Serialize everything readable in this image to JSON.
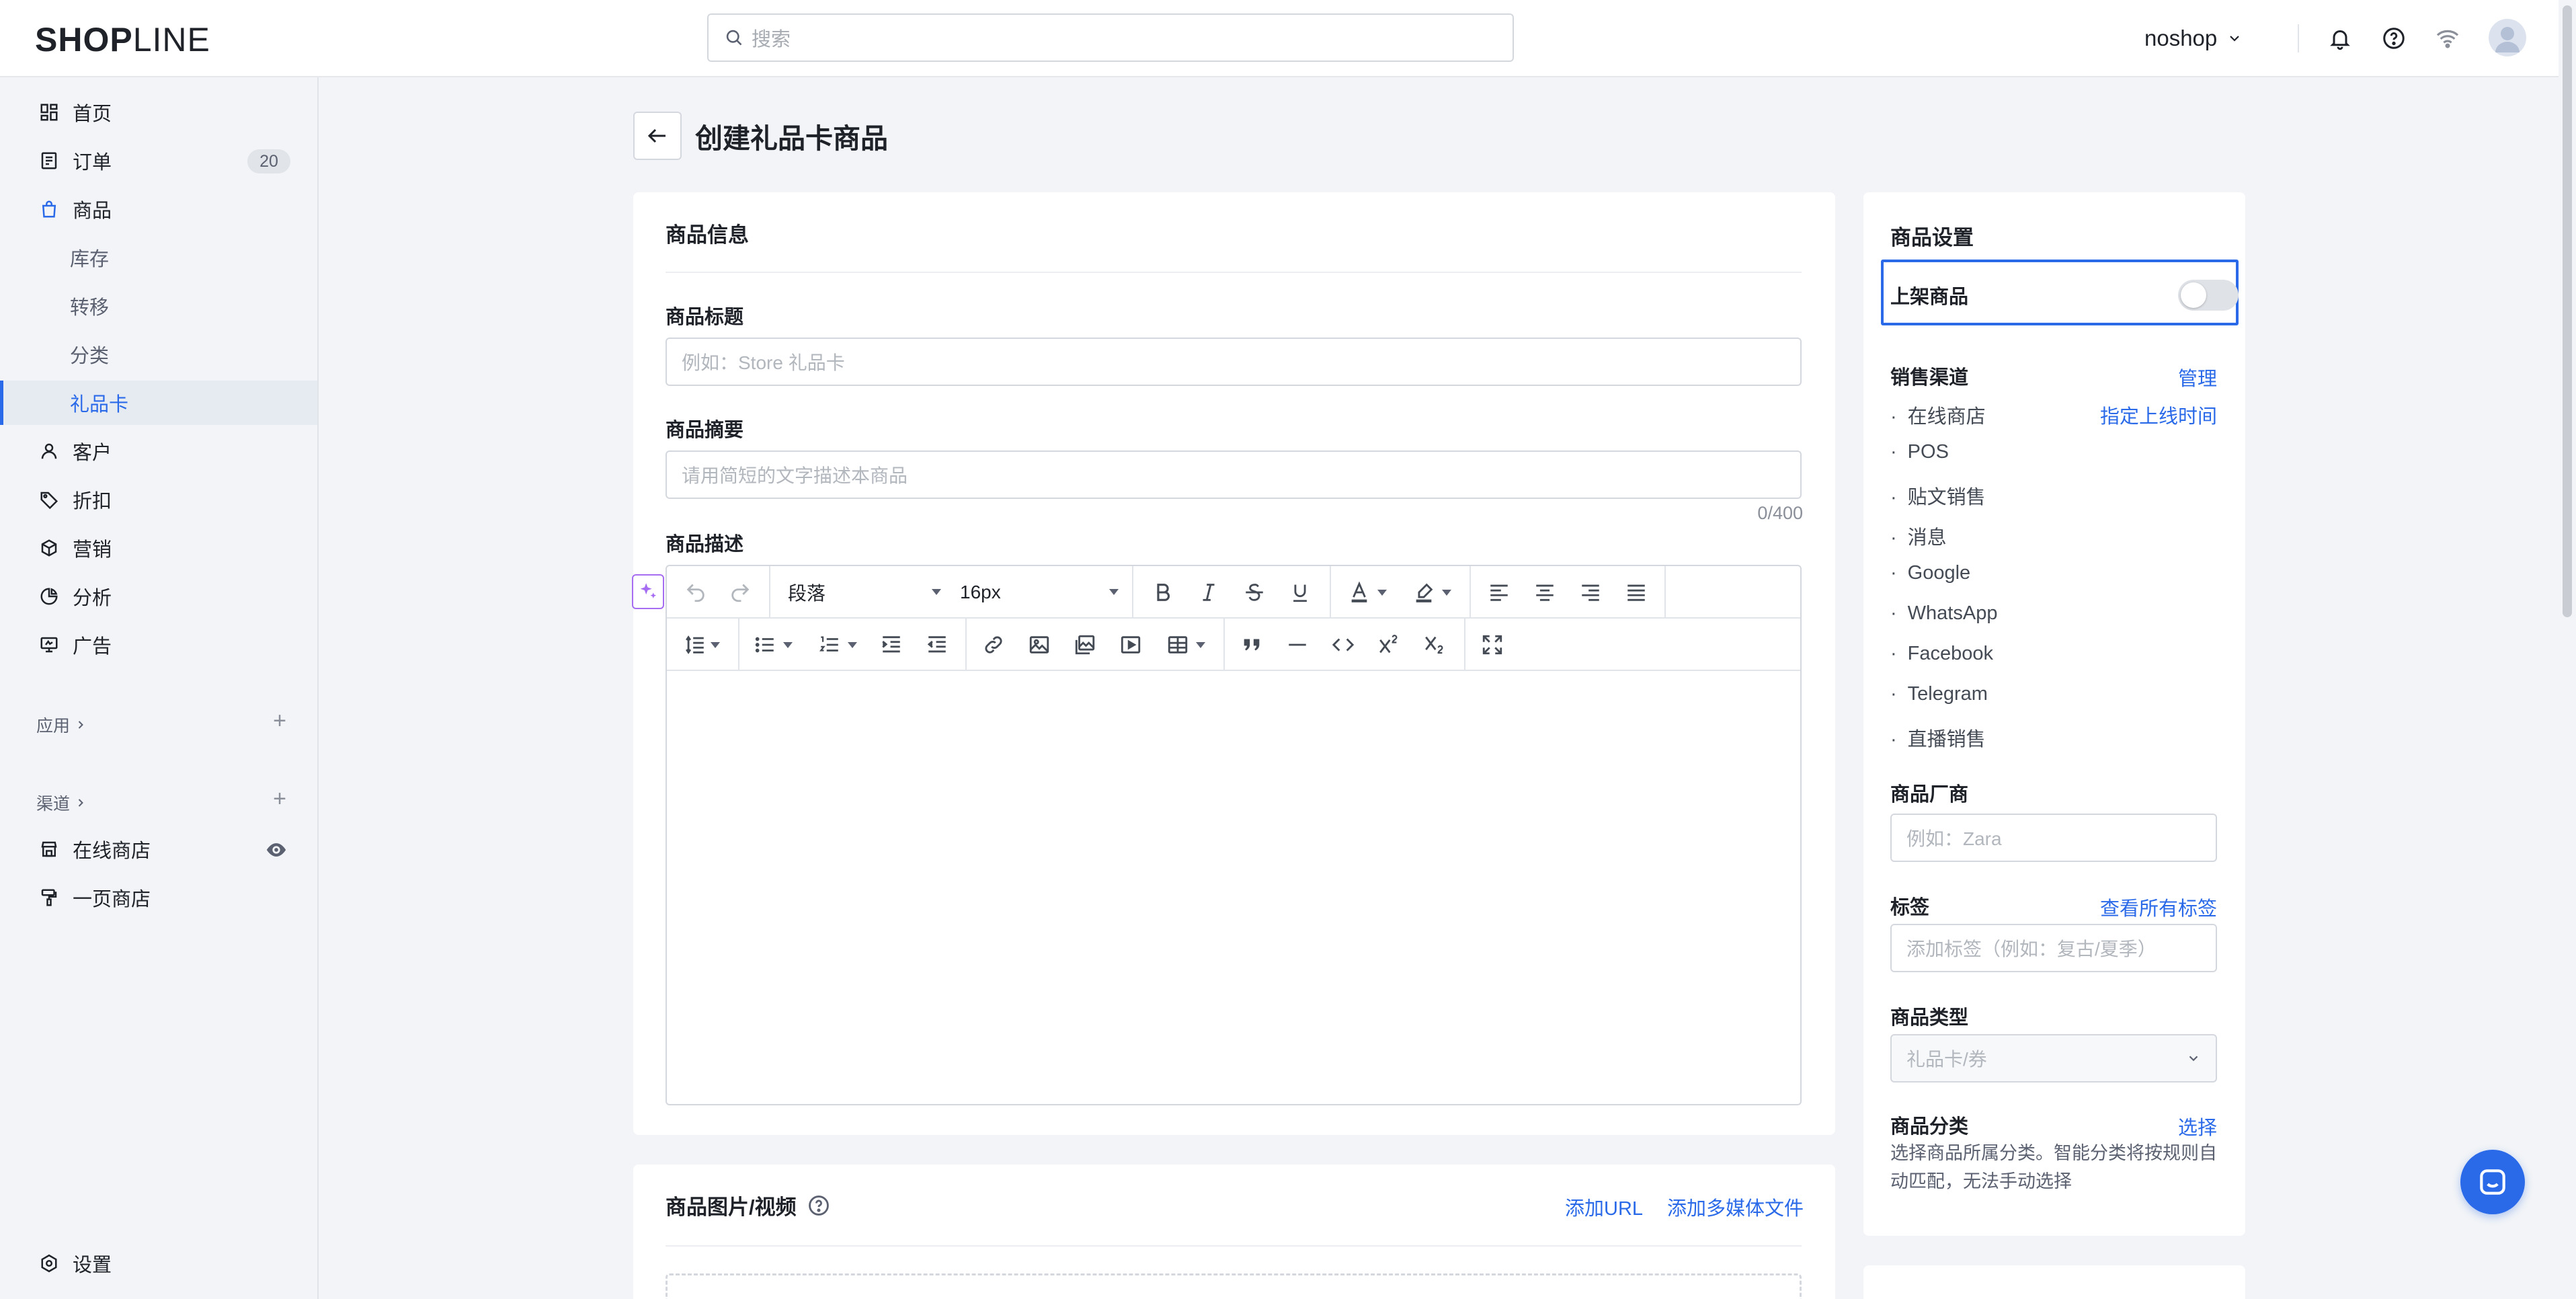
{
  "app": {
    "logo_bold": "SHOP",
    "logo_light": "LINE",
    "search_placeholder": "搜索",
    "shop_name": "noshop"
  },
  "sidebar": {
    "items": [
      {
        "label": "首页",
        "icon": "dashboard-icon"
      },
      {
        "label": "订单",
        "icon": "order-icon",
        "badge": "20"
      },
      {
        "label": "商品",
        "icon": "bag-icon"
      },
      {
        "label": "库存"
      },
      {
        "label": "转移"
      },
      {
        "label": "分类"
      },
      {
        "label": "礼品卡"
      },
      {
        "label": "客户",
        "icon": "user-icon"
      },
      {
        "label": "折扣",
        "icon": "tag-icon"
      },
      {
        "label": "营销",
        "icon": "cube-icon"
      },
      {
        "label": "分析",
        "icon": "pie-icon"
      },
      {
        "label": "广告",
        "icon": "ad-icon"
      }
    ],
    "apps_label": "应用",
    "channels_label": "渠道",
    "channels": [
      "在线商店",
      "一页商店"
    ],
    "settings_label": "设置"
  },
  "page": {
    "title": "创建礼品卡商品"
  },
  "product_info": {
    "card_title": "商品信息",
    "title_label": "商品标题",
    "title_placeholder": "例如：Store 礼品卡",
    "summary_label": "商品摘要",
    "summary_placeholder": "请用简短的文字描述本商品",
    "summary_counter": "0/400",
    "description_label": "商品描述",
    "editor": {
      "paragraph_select": "段落",
      "font_size_select": "16px"
    }
  },
  "media": {
    "card_title": "商品图片/视频",
    "add_url": "添加URL",
    "add_media": "添加多媒体文件"
  },
  "settings_panel": {
    "title": "商品设置",
    "publish_label": "上架商品",
    "publish_on": false,
    "sales_channel_label": "销售渠道",
    "manage_link": "管理",
    "schedule_link": "指定上线时间",
    "channels": [
      "在线商店",
      "POS",
      "贴文销售",
      "消息",
      "Google",
      "WhatsApp",
      "Facebook",
      "Telegram",
      "直播销售"
    ],
    "vendor_label": "商品厂商",
    "vendor_placeholder": "例如：Zara",
    "tags_label": "标签",
    "view_all_tags": "查看所有标签",
    "tags_placeholder": "添加标签（例如：复古/夏季）",
    "type_label": "商品类型",
    "type_value": "礼品卡/券",
    "category_label": "商品分类",
    "category_select": "选择",
    "category_desc": "选择商品所属分类。智能分类将按规则自动匹配，无法手动选择"
  },
  "colors": {
    "accent": "#2a6ae9",
    "ai": "#a66cf2"
  }
}
